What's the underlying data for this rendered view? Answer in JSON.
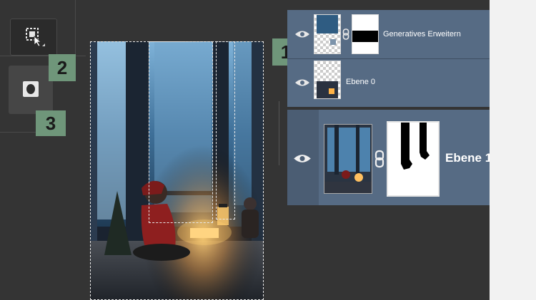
{
  "badges": {
    "one": "1",
    "two": "2",
    "three": "3"
  },
  "layers_panel_small": {
    "rows": [
      {
        "name": "Generatives Erweitern"
      },
      {
        "name": "Ebene 0"
      }
    ]
  },
  "layers_panel_large": {
    "rows": [
      {
        "name": "Ebene 1"
      }
    ]
  },
  "colors": {
    "panel_blue": "#566b84",
    "badge_green": "#6f967a",
    "workspace": "#343434"
  },
  "icons": {
    "tool1": "generative-expand-selection-icon",
    "tool2": "layer-mask-icon",
    "eye": "eye-icon",
    "link": "chain-link-icon"
  }
}
